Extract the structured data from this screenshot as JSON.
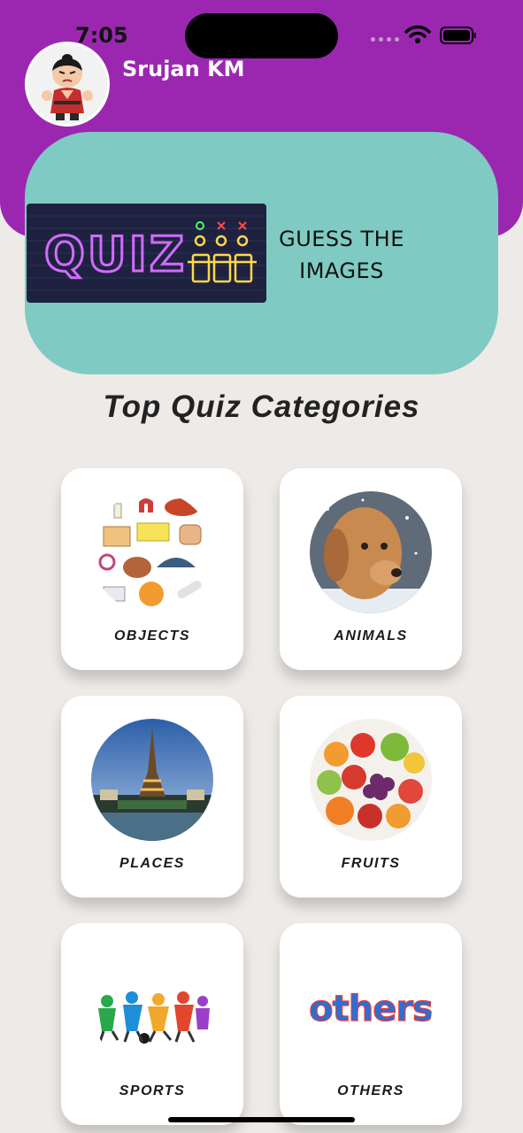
{
  "status_bar": {
    "time": "7:05"
  },
  "profile": {
    "name": "Srujan KM"
  },
  "banner": {
    "sign_text": "QUIZ",
    "line1": "GUESS THE",
    "line2": "IMAGES"
  },
  "section": {
    "title": "Top Quiz Categories"
  },
  "categories": [
    {
      "label": "OBJECTS"
    },
    {
      "label": "ANIMALS"
    },
    {
      "label": "PLACES"
    },
    {
      "label": "FRUITS"
    },
    {
      "label": "SPORTS"
    },
    {
      "label": "OTHERS",
      "art_text": "others"
    }
  ],
  "colors": {
    "header": "#9b27b0",
    "banner": "#7fcbc3",
    "background": "#eeeae7"
  }
}
